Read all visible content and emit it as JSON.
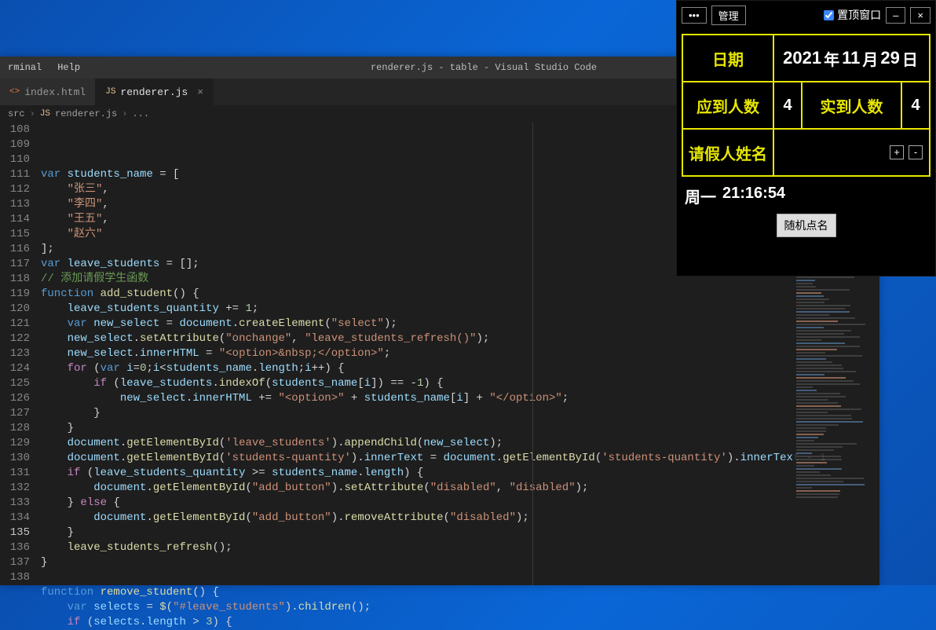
{
  "vscode": {
    "menu": {
      "terminal": "rminal",
      "help": "Help"
    },
    "title": "renderer.js - table - Visual Studio Code",
    "tabs": [
      {
        "icon": "<>",
        "label": "index.html",
        "active": false
      },
      {
        "icon": "JS",
        "label": "renderer.js",
        "active": true
      }
    ],
    "breadcrumb": {
      "src": "src",
      "file": "renderer.js",
      "more": "..."
    },
    "first_line_no": 108,
    "highlight_line_no": 135,
    "code_lines": [
      [
        [
          "kw",
          "var"
        ],
        [
          "pun",
          " "
        ],
        [
          "var",
          "students_name"
        ],
        [
          "pun",
          " = ["
        ]
      ],
      [
        [
          "pun",
          "    "
        ],
        [
          "str",
          "\"张三\""
        ],
        [
          "pun",
          ","
        ]
      ],
      [
        [
          "pun",
          "    "
        ],
        [
          "str",
          "\"李四\""
        ],
        [
          "pun",
          ","
        ]
      ],
      [
        [
          "pun",
          "    "
        ],
        [
          "str",
          "\"王五\""
        ],
        [
          "pun",
          ","
        ]
      ],
      [
        [
          "pun",
          "    "
        ],
        [
          "str",
          "\"赵六\""
        ]
      ],
      [
        [
          "pun",
          "];"
        ]
      ],
      [
        [
          "kw",
          "var"
        ],
        [
          "pun",
          " "
        ],
        [
          "var",
          "leave_students"
        ],
        [
          "pun",
          " = [];"
        ]
      ],
      [
        [
          "cmt",
          "// 添加请假学生函数"
        ]
      ],
      [
        [
          "kw",
          "function"
        ],
        [
          "pun",
          " "
        ],
        [
          "fn",
          "add_student"
        ],
        [
          "pun",
          "() {"
        ]
      ],
      [
        [
          "pun",
          "    "
        ],
        [
          "var",
          "leave_students_quantity"
        ],
        [
          "pun",
          " += "
        ],
        [
          "num",
          "1"
        ],
        [
          "pun",
          ";"
        ]
      ],
      [
        [
          "pun",
          "    "
        ],
        [
          "kw",
          "var"
        ],
        [
          "pun",
          " "
        ],
        [
          "var",
          "new_select"
        ],
        [
          "pun",
          " = "
        ],
        [
          "var",
          "document"
        ],
        [
          "pun",
          "."
        ],
        [
          "fn",
          "createElement"
        ],
        [
          "pun",
          "("
        ],
        [
          "str",
          "\"select\""
        ],
        [
          "pun",
          ");"
        ]
      ],
      [
        [
          "pun",
          "    "
        ],
        [
          "var",
          "new_select"
        ],
        [
          "pun",
          "."
        ],
        [
          "fn",
          "setAttribute"
        ],
        [
          "pun",
          "("
        ],
        [
          "str",
          "\"onchange\""
        ],
        [
          "pun",
          ", "
        ],
        [
          "str",
          "\"leave_students_refresh()\""
        ],
        [
          "pun",
          ");"
        ]
      ],
      [
        [
          "pun",
          "    "
        ],
        [
          "var",
          "new_select"
        ],
        [
          "pun",
          "."
        ],
        [
          "var",
          "innerHTML"
        ],
        [
          "pun",
          " = "
        ],
        [
          "str",
          "\"<option>&nbsp;</option>\""
        ],
        [
          "pun",
          ";"
        ]
      ],
      [
        [
          "pun",
          "    "
        ],
        [
          "ctl",
          "for"
        ],
        [
          "pun",
          " ("
        ],
        [
          "kw",
          "var"
        ],
        [
          "pun",
          " "
        ],
        [
          "var",
          "i"
        ],
        [
          "pun",
          "="
        ],
        [
          "num",
          "0"
        ],
        [
          "pun",
          ";"
        ],
        [
          "var",
          "i"
        ],
        [
          "pun",
          "<"
        ],
        [
          "var",
          "students_name"
        ],
        [
          "pun",
          "."
        ],
        [
          "var",
          "length"
        ],
        [
          "pun",
          ";"
        ],
        [
          "var",
          "i"
        ],
        [
          "pun",
          "++) {"
        ]
      ],
      [
        [
          "pun",
          "        "
        ],
        [
          "ctl",
          "if"
        ],
        [
          "pun",
          " ("
        ],
        [
          "var",
          "leave_students"
        ],
        [
          "pun",
          "."
        ],
        [
          "fn",
          "indexOf"
        ],
        [
          "pun",
          "("
        ],
        [
          "var",
          "students_name"
        ],
        [
          "pun",
          "["
        ],
        [
          "var",
          "i"
        ],
        [
          "pun",
          "]) == -"
        ],
        [
          "num",
          "1"
        ],
        [
          "pun",
          ") {"
        ]
      ],
      [
        [
          "pun",
          "            "
        ],
        [
          "var",
          "new_select"
        ],
        [
          "pun",
          "."
        ],
        [
          "var",
          "innerHTML"
        ],
        [
          "pun",
          " += "
        ],
        [
          "str",
          "\"<option>\""
        ],
        [
          "pun",
          " + "
        ],
        [
          "var",
          "students_name"
        ],
        [
          "pun",
          "["
        ],
        [
          "var",
          "i"
        ],
        [
          "pun",
          "] + "
        ],
        [
          "str",
          "\"</option>\""
        ],
        [
          "pun",
          ";"
        ]
      ],
      [
        [
          "pun",
          "        }"
        ]
      ],
      [
        [
          "pun",
          "    }"
        ]
      ],
      [
        [
          "pun",
          "    "
        ],
        [
          "var",
          "document"
        ],
        [
          "pun",
          "."
        ],
        [
          "fn",
          "getElementById"
        ],
        [
          "pun",
          "("
        ],
        [
          "str",
          "'leave_students'"
        ],
        [
          "pun",
          ")."
        ],
        [
          "fn",
          "appendChild"
        ],
        [
          "pun",
          "("
        ],
        [
          "var",
          "new_select"
        ],
        [
          "pun",
          ");"
        ]
      ],
      [
        [
          "pun",
          "    "
        ],
        [
          "var",
          "document"
        ],
        [
          "pun",
          "."
        ],
        [
          "fn",
          "getElementById"
        ],
        [
          "pun",
          "("
        ],
        [
          "str",
          "'students-quantity'"
        ],
        [
          "pun",
          ")."
        ],
        [
          "var",
          "innerText"
        ],
        [
          "pun",
          " = "
        ],
        [
          "var",
          "document"
        ],
        [
          "pun",
          "."
        ],
        [
          "fn",
          "getElementById"
        ],
        [
          "pun",
          "("
        ],
        [
          "str",
          "'students-quantity'"
        ],
        [
          "pun",
          ")."
        ],
        [
          "var",
          "innerText"
        ],
        [
          "pun",
          " - "
        ],
        [
          "num",
          "1"
        ]
      ],
      [
        [
          "pun",
          "    "
        ],
        [
          "ctl",
          "if"
        ],
        [
          "pun",
          " ("
        ],
        [
          "var",
          "leave_students_quantity"
        ],
        [
          "pun",
          " >= "
        ],
        [
          "var",
          "students_name"
        ],
        [
          "pun",
          "."
        ],
        [
          "var",
          "length"
        ],
        [
          "pun",
          ") {"
        ]
      ],
      [
        [
          "pun",
          "        "
        ],
        [
          "var",
          "document"
        ],
        [
          "pun",
          "."
        ],
        [
          "fn",
          "getElementById"
        ],
        [
          "pun",
          "("
        ],
        [
          "str",
          "\"add_button\""
        ],
        [
          "pun",
          ")."
        ],
        [
          "fn",
          "setAttribute"
        ],
        [
          "pun",
          "("
        ],
        [
          "str",
          "\"disabled\""
        ],
        [
          "pun",
          ", "
        ],
        [
          "str",
          "\"disabled\""
        ],
        [
          "pun",
          ");"
        ]
      ],
      [
        [
          "pun",
          "    } "
        ],
        [
          "ctl",
          "else"
        ],
        [
          "pun",
          " {"
        ]
      ],
      [
        [
          "pun",
          "        "
        ],
        [
          "var",
          "document"
        ],
        [
          "pun",
          "."
        ],
        [
          "fn",
          "getElementById"
        ],
        [
          "pun",
          "("
        ],
        [
          "str",
          "\"add_button\""
        ],
        [
          "pun",
          ")."
        ],
        [
          "fn",
          "removeAttribute"
        ],
        [
          "pun",
          "("
        ],
        [
          "str",
          "\"disabled\""
        ],
        [
          "pun",
          ");"
        ]
      ],
      [
        [
          "pun",
          "    }"
        ]
      ],
      [
        [
          "pun",
          "    "
        ],
        [
          "fn",
          "leave_students_refresh"
        ],
        [
          "pun",
          "();"
        ]
      ],
      [
        [
          "pun",
          "}"
        ]
      ],
      [
        [
          "pun",
          ""
        ]
      ],
      [
        [
          "kw",
          "function"
        ],
        [
          "pun",
          " "
        ],
        [
          "fn",
          "remove_student"
        ],
        [
          "pun",
          "() {"
        ]
      ],
      [
        [
          "pun",
          "    "
        ],
        [
          "kw",
          "var"
        ],
        [
          "pun",
          " "
        ],
        [
          "var",
          "selects"
        ],
        [
          "pun",
          " = "
        ],
        [
          "fn",
          "$"
        ],
        [
          "pun",
          "("
        ],
        [
          "str",
          "\"#leave_students\""
        ],
        [
          "pun",
          ")."
        ],
        [
          "fn",
          "children"
        ],
        [
          "pun",
          "();"
        ]
      ],
      [
        [
          "pun",
          "    "
        ],
        [
          "ctl",
          "if"
        ],
        [
          "pun",
          " ("
        ],
        [
          "var",
          "selects"
        ],
        [
          "pun",
          "."
        ],
        [
          "var",
          "length"
        ],
        [
          "pun",
          " > "
        ],
        [
          "num",
          "3"
        ],
        [
          "pun",
          ") {"
        ]
      ]
    ]
  },
  "overlay": {
    "menu_dots": "•••",
    "manage": "管理",
    "pin_label": "置顶窗口",
    "pin_checked": true,
    "minimize": "–",
    "close": "×",
    "date_label": "日期",
    "year": "2021",
    "year_u": "年",
    "month": "11",
    "month_u": "月",
    "day": "29",
    "day_u": "日",
    "expected_label": "应到人数",
    "expected": "4",
    "actual_label": "实到人数",
    "actual": "4",
    "leave_label": "请假人姓名",
    "plus": "+",
    "minus": "-",
    "weekday": "周一",
    "time": "21:16:54",
    "random": "随机点名"
  }
}
